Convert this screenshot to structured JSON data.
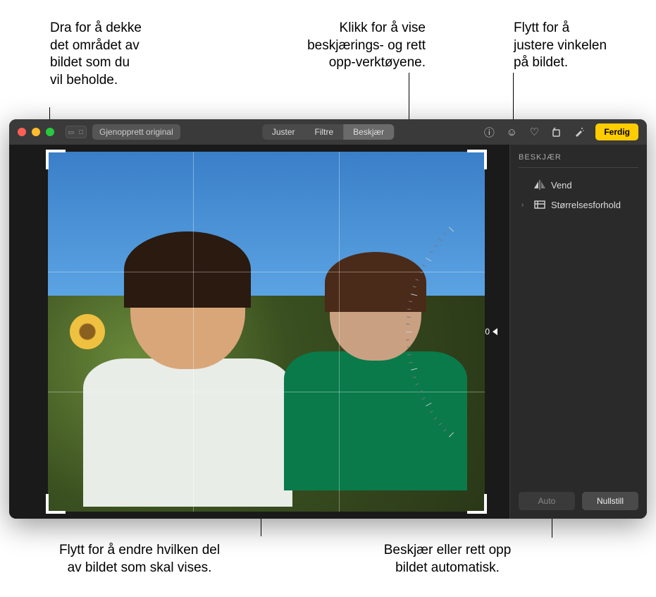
{
  "callouts": {
    "drag_crop": "Dra for å dekke\ndet området av\nbildet som du\nvil beholde.",
    "click_crop_tools": "Klikk for å vise\nbeskjærings- og rett\nopp-verktøyene.",
    "move_angle": "Flytt for å\njustere vinkelen\npå bildet.",
    "move_image": "Flytt for å endre hvilken del\nav bildet som skal vises.",
    "auto_crop": "Beskjær eller rett opp\nbildet automatisk."
  },
  "toolbar": {
    "restore_original": "Gjenopprett original",
    "done": "Ferdig",
    "tabs": {
      "adjust": "Juster",
      "filters": "Filtre",
      "crop": "Beskjær"
    }
  },
  "sidebar": {
    "title": "BESKJÆR",
    "flip": "Vend",
    "aspect": "Størrelsesforhold",
    "auto": "Auto",
    "reset": "Nullstill"
  },
  "dial": {
    "value": "0"
  }
}
